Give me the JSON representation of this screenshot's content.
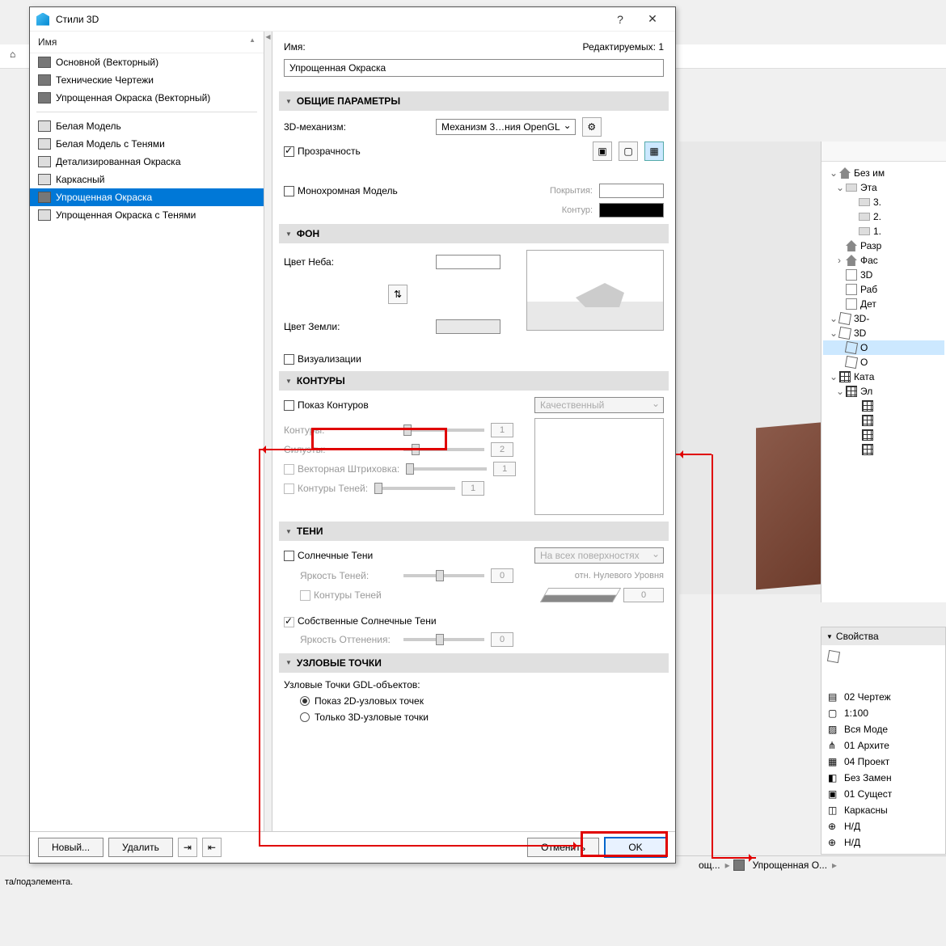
{
  "dialog": {
    "title": "Стили 3D",
    "left": {
      "header": "Имя",
      "group1": [
        "Основной (Векторный)",
        "Технические Чертежи",
        "Упрощенная Окраска (Векторный)"
      ],
      "group2": [
        "Белая Модель",
        "Белая Модель с Тенями",
        "Детализированная Окраска",
        "Каркасный",
        "Упрощенная Окраска",
        "Упрощенная Окраска с Тенями"
      ],
      "selected": "Упрощенная Окраска"
    },
    "right": {
      "name_label": "Имя:",
      "editable": "Редактируемых: 1",
      "name_value": "Упрощенная Окраска",
      "sec_general": "ОБЩИЕ ПАРАМЕТРЫ",
      "mech_label": "3D-механизм:",
      "mech_value": "Механизм 3…ния OpenGL",
      "transparency": "Прозрачность",
      "mono": "Монохромная Модель",
      "cover_label": "Покрытия:",
      "contour_label": "Контур:",
      "sec_bg": "ФОН",
      "sky_label": "Цвет Неба:",
      "ground_label": "Цвет Земли:",
      "visualizations": "Визуализации",
      "sec_contours": "КОНТУРЫ",
      "show_contours": "Показ Контуров",
      "quality": "Качественный",
      "contours_label": "Контуры:",
      "silhouettes_label": "Силуэты:",
      "vector_hatch": "Векторная Штриховка:",
      "shadow_contours": "Контуры Теней:",
      "val1": "1",
      "val2": "2",
      "sec_shadows": "ТЕНИ",
      "sun_shadows": "Солнечные Тени",
      "all_surfaces": "На всех поверхностях",
      "shadow_brightness": "Яркость Теней:",
      "shadow_brightness_val": "0",
      "rel_zero": "отн. Нулевого Уровня",
      "shadow_cont2": "Контуры Теней",
      "zero_val": "0",
      "own_shadows": "Собственные Солнечные Тени",
      "shade_brightness": "Яркость Оттенения:",
      "shade_val": "0",
      "sec_nodes": "УЗЛОВЫЕ ТОЧКИ",
      "gdl_nodes": "Узловые Точки GDL-объектов:",
      "radio_2d": "Показ 2D-узловых точек",
      "radio_3d": "Только 3D-узловые точки"
    },
    "footer": {
      "new": "Новый...",
      "delete": "Удалить",
      "cancel": "Отменить",
      "ok": "OK"
    }
  },
  "nav": {
    "root": "Без им",
    "items": [
      {
        "l": 1,
        "chev": "⌄",
        "ico": "folder",
        "t": "Эта"
      },
      {
        "l": 2,
        "chev": "",
        "ico": "folder",
        "t": "3."
      },
      {
        "l": 2,
        "chev": "",
        "ico": "folder",
        "t": "2."
      },
      {
        "l": 2,
        "chev": "",
        "ico": "folder",
        "t": "1."
      },
      {
        "l": 1,
        "chev": "",
        "ico": "home",
        "t": "Разр"
      },
      {
        "l": 1,
        "chev": "›",
        "ico": "home",
        "t": "Фас"
      },
      {
        "l": 1,
        "chev": "",
        "ico": "sheet",
        "t": "3D"
      },
      {
        "l": 1,
        "chev": "",
        "ico": "sheet",
        "t": "Раб"
      },
      {
        "l": 1,
        "chev": "",
        "ico": "sheet",
        "t": "Дет"
      },
      {
        "l": 0,
        "chev": "⌄",
        "ico": "cube",
        "t": "3D-"
      },
      {
        "l": 0,
        "chev": "⌄",
        "ico": "cube",
        "t": "3D"
      },
      {
        "l": 1,
        "chev": "",
        "ico": "cube",
        "t": "О",
        "sel": true
      },
      {
        "l": 1,
        "chev": "",
        "ico": "cube",
        "t": "О"
      },
      {
        "l": 0,
        "chev": "⌄",
        "ico": "grid",
        "t": "Ката"
      },
      {
        "l": 1,
        "chev": "⌄",
        "ico": "grid",
        "t": "Эл"
      }
    ]
  },
  "props": {
    "header": "Свойства",
    "rows": [
      "02 Чертеж",
      "1:100",
      "Вся Моде",
      "01 Архите",
      "04 Проект",
      "Без Замен",
      "01 Сущест",
      "Каркасны",
      "Н/Д",
      "Н/Д"
    ]
  },
  "status": {
    "crumb1": "ощ...",
    "crumb2": "Упрощенная О...",
    "bottom": "та/подэлемента."
  }
}
